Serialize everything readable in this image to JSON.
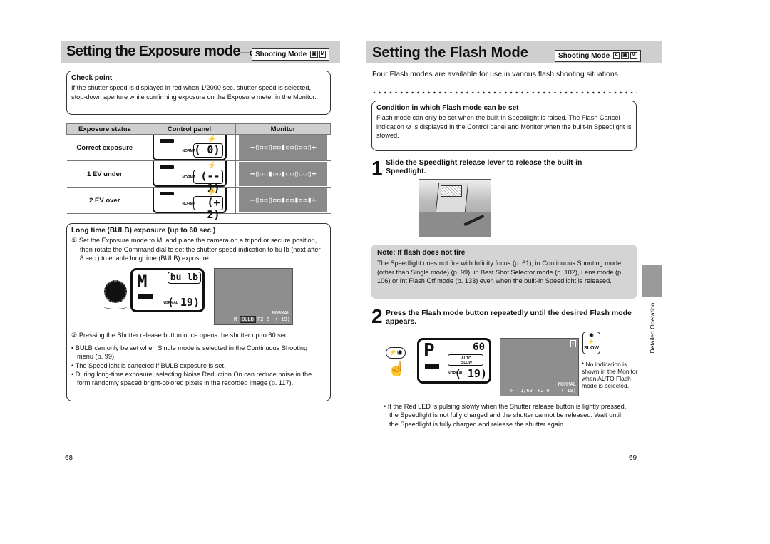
{
  "left_page": {
    "title": "Setting the Exposure mode",
    "title_suffix": "—continued",
    "mode_badge": {
      "label": "Shooting Mode",
      "icons": [
        "camera-icon",
        "manual-icon"
      ],
      "icon_glyphs": [
        "▣",
        "M"
      ]
    },
    "check_point": {
      "title": "Check point",
      "text": "If the shutter speed is displayed in red when 1/2000 sec. shutter speed is selected, stop-down aperture while confirming exposure on the Exposure meter in the Monitor."
    },
    "exposure_table": {
      "headers": [
        "Exposure status",
        "Control panel",
        "Monitor"
      ],
      "rows": [
        {
          "status": "Correct exposure",
          "panel_label": "NORMA",
          "panel_readout": "(    0)",
          "meter": "—▯▫▫▯▫▫▮▫▫▯▫▫▯+"
        },
        {
          "status": "1 EV under",
          "panel_label": "NORMA",
          "panel_readout": "(-- 1)",
          "meter": "—▯▫▫▮▫▫▮▫▫▯▫▫▯+"
        },
        {
          "status": "2 EV over",
          "panel_label": "NORMA",
          "panel_readout": "(+ 2)",
          "meter": "—▯▫▫▯▫▫▮▫▫▮▫▫▮+"
        }
      ],
      "flash_glyph": "⚡"
    },
    "bulb_box": {
      "title": "Long time (BULB) exposure (up to 60 sec.)",
      "step1_marker": "①",
      "step1_text": "Set the Exposure mode to M, and place the camera on a tripod or secure position, then rotate the Command dial to set the shutter speed indication to bu lb (next after 8 sec.) to enable long time (BULB) exposure.",
      "lcd": {
        "mode": "M",
        "shutter": "bu lb",
        "quality": "NORMAL",
        "frames": "( 19)"
      },
      "monitor": {
        "mode": "M",
        "shutter": "BULB",
        "aperture": "F2.6",
        "quality": "NORMAL",
        "frames": "( 19)"
      },
      "step2_marker": "②",
      "step2_text": "Pressing the Shutter release button once opens the shutter up to 60 sec.",
      "bullets": [
        "BULB can only be set when Single mode is selected in the Continuous Shooting menu (p. 99).",
        "The Speedlight is canceled if BULB exposure is set.",
        "During long-time exposure, selecting Noise Reduction On can reduce noise in the form randomly spaced bright-colored pixels in the recorded image (p. 117)."
      ]
    },
    "page_number": "68"
  },
  "right_page": {
    "title": "Setting the Flash Mode",
    "mode_badge": {
      "label": "Shooting Mode",
      "icons": [
        "auto-icon",
        "camera-icon",
        "manual-icon"
      ],
      "icon_glyphs": [
        "A",
        "▣",
        "M"
      ]
    },
    "intro": "Four Flash modes are available for use in various flash shooting situations.",
    "condition_box": {
      "title": "Condition in which Flash mode can be set",
      "text": "Flash mode can only be set when the built-in Speedlight is raised. The Flash Cancel indication ⊘ is displayed in the Control panel and Monitor when the built-in Speedlight is stowed."
    },
    "step1": {
      "number": "1",
      "text": "Slide the Speedlight release lever to release the built-in Speedlight."
    },
    "note_box": {
      "title": "Note: If flash does not fire",
      "text": "The Speedlight does not fire with Infinity focus (p. 61), in Continuous Shooting mode (other than Single mode) (p. 99), in Best Shot Selector mode (p. 102), Lens mode (p. 106) or Int Flash Off mode (p. 133) even when the built-in Speedlight is released."
    },
    "step2": {
      "number": "2",
      "text": "Press the Flash mode button repeatedly until the desired Flash mode appears."
    },
    "flash_button_glyph": "⚡◉",
    "lcd": {
      "mode": "P",
      "shutter": "60",
      "flash_mode": "AUTO SLOW",
      "quality": "NORMAL",
      "frames": "( 19)"
    },
    "monitor": {
      "mode": "P",
      "shutter": "1/60",
      "aperture": "F2.6",
      "quality": "NORMAL",
      "frames": "( 19)",
      "flash_icon": "⚡"
    },
    "callout": {
      "line1": "◉",
      "line2": "⚡",
      "line3": "SLOW"
    },
    "footnote": "* No indication is shown in the Monitor when AUTO Flash mode is selected.",
    "bullet": "If the Red LED is pulsing slowly when the Shutter release button is lightly pressed, the Speedlight is not fully charged and the shutter cannot be released. Wait until the Speedlight is fully charged and release the shutter again.",
    "side_tab_label": "Detailed Operation",
    "page_number": "69"
  }
}
